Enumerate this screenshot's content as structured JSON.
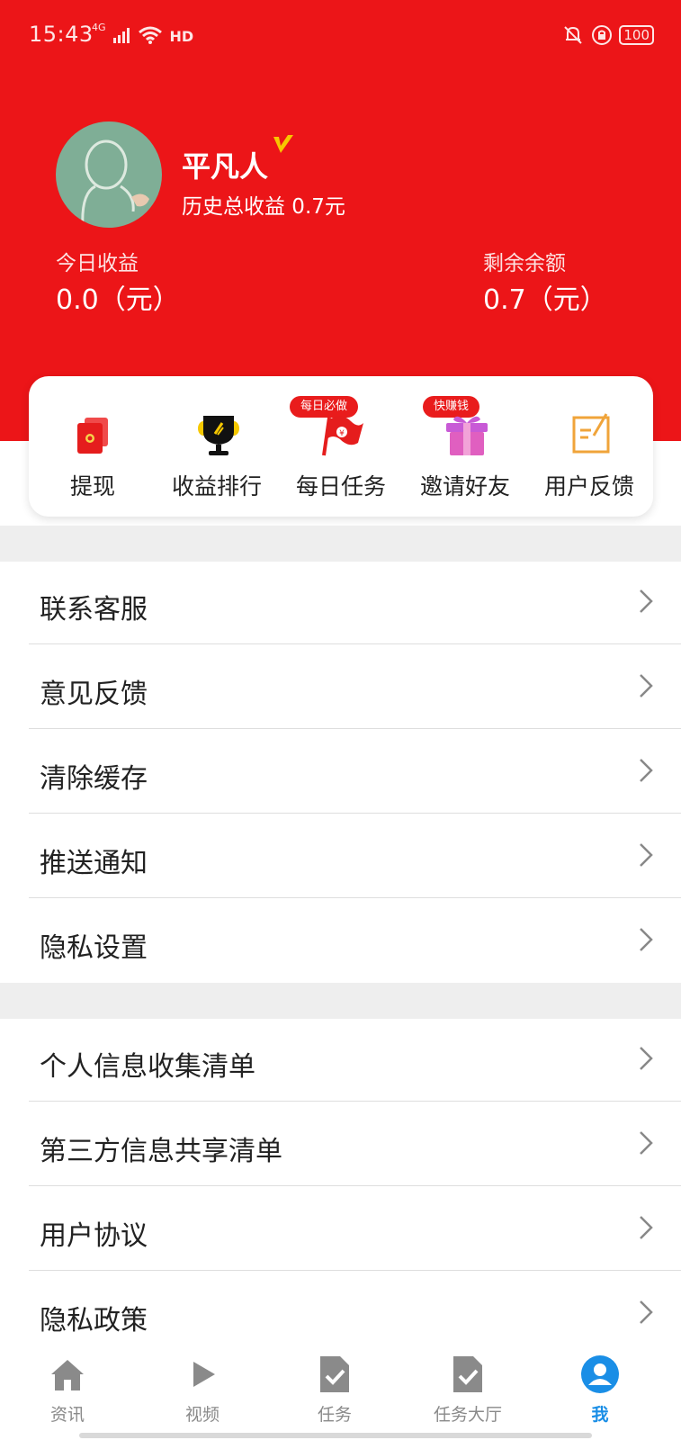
{
  "status_bar": {
    "time": "15:43",
    "network_label": "4G",
    "hd_label": "HD",
    "battery": "100"
  },
  "profile": {
    "name": "平凡人",
    "total_income": "历史总收益 0.7元",
    "today_label": "今日收益",
    "today_value": "0.0（元）",
    "balance_label": "剩余余额",
    "balance_value": "0.7（元）"
  },
  "actions": [
    {
      "label": "提现",
      "icon": "red-envelope-icon"
    },
    {
      "label": "收益排行",
      "icon": "trophy-icon"
    },
    {
      "label": "每日任务",
      "icon": "flag-icon",
      "badge": "每日必做"
    },
    {
      "label": "邀请好友",
      "icon": "gift-icon",
      "badge": "快赚钱"
    },
    {
      "label": "用户反馈",
      "icon": "edit-note-icon"
    }
  ],
  "menu_group_1": [
    "联系客服",
    "意见反馈",
    "清除缓存",
    "推送通知",
    "隐私设置"
  ],
  "menu_group_2": [
    "个人信息收集清单",
    "第三方信息共享清单",
    "用户协议",
    "隐私政策"
  ],
  "bottom_nav": [
    {
      "label": "资讯",
      "icon": "home-icon"
    },
    {
      "label": "视频",
      "icon": "play-icon"
    },
    {
      "label": "任务",
      "icon": "task-doc-icon"
    },
    {
      "label": "任务大厅",
      "icon": "task-hall-icon"
    },
    {
      "label": "我",
      "icon": "user-icon",
      "active": true
    }
  ],
  "colors": {
    "header": "#ec1518",
    "active_nav": "#1a8ee6",
    "badge": "#e91c1c"
  }
}
